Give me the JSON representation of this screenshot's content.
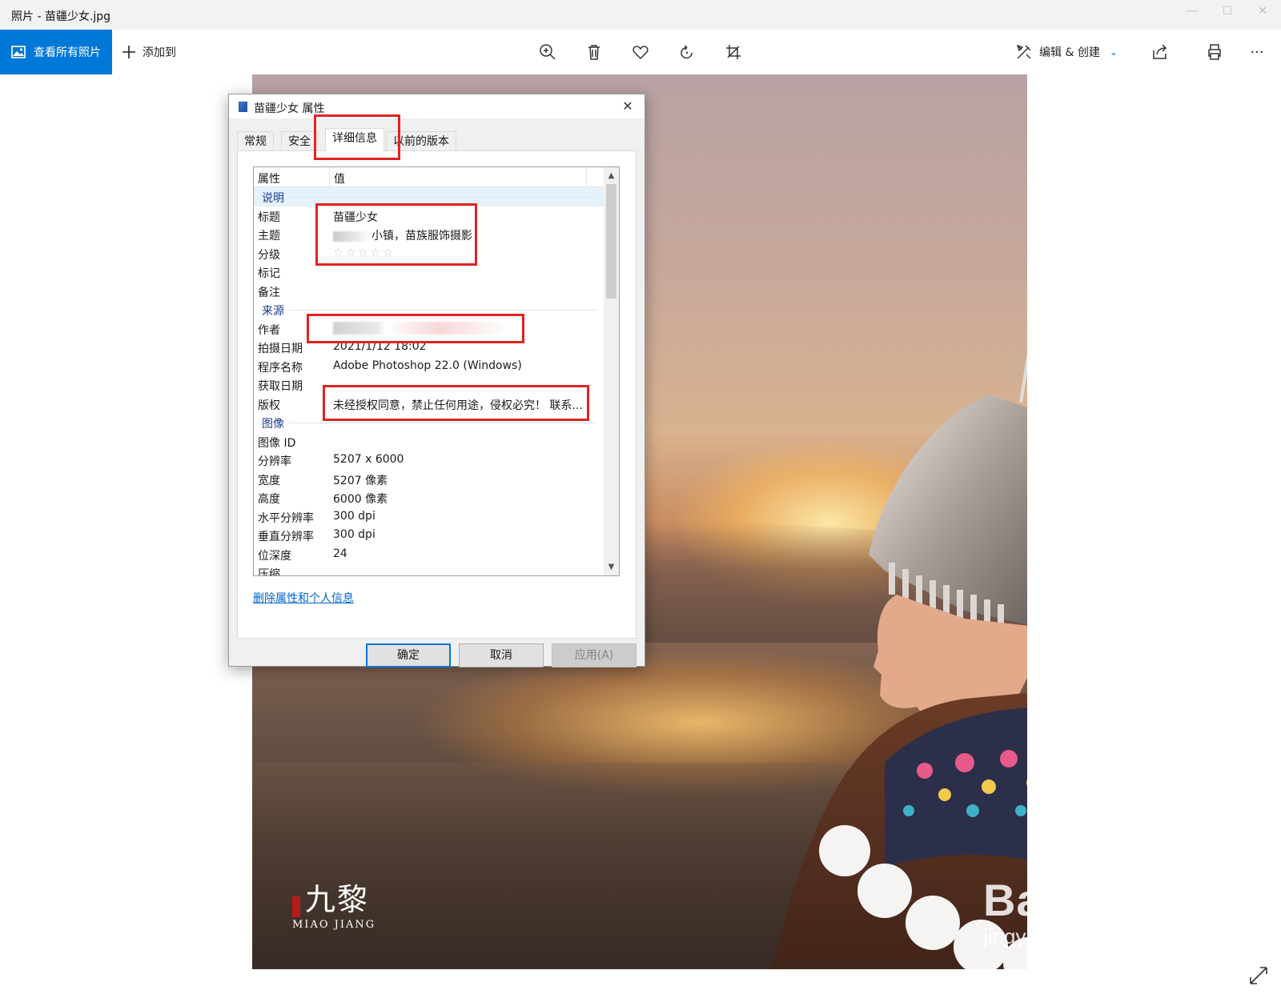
{
  "window": {
    "title": "照片 - 苗疆少女.jpg",
    "minimize": "—",
    "maximize": "☐",
    "close": "✕"
  },
  "toolbar": {
    "view_all_label": "查看所有照片",
    "add_to_label": "添加到",
    "edit_create_label": "编辑 & 创建",
    "edit_create_chevron": "⌄",
    "more_label": "···"
  },
  "dialog": {
    "title": "苗疆少女 属性",
    "close": "✕",
    "tabs": [
      "常规",
      "安全",
      "详细信息",
      "以前的版本"
    ],
    "active_tab": "详细信息",
    "columns": {
      "property": "属性",
      "value": "值"
    },
    "groups": {
      "description": "说明",
      "origin": "来源",
      "image": "图像"
    },
    "rows": {
      "title": {
        "k": "标题",
        "v": "苗疆少女"
      },
      "subject": {
        "k": "主题",
        "v": "小镇，苗族服饰摄影"
      },
      "rating": {
        "k": "分级",
        "v": "☆☆☆☆☆"
      },
      "tags": {
        "k": "标记",
        "v": ""
      },
      "comments": {
        "k": "备注",
        "v": ""
      },
      "authors": {
        "k": "作者",
        "v": ""
      },
      "date_taken": {
        "k": "拍摄日期",
        "v": "2021/1/12 18:02"
      },
      "program": {
        "k": "程序名称",
        "v": "Adobe Photoshop 22.0 (Windows)"
      },
      "date_acquired": {
        "k": "获取日期",
        "v": ""
      },
      "copyright": {
        "k": "版权",
        "v": "未经授权同意，禁止任何用途，侵权必究！ 联系..."
      },
      "image_id": {
        "k": "图像 ID",
        "v": ""
      },
      "dimensions": {
        "k": "分辨率",
        "v": "5207 x 6000"
      },
      "width": {
        "k": "宽度",
        "v": "5207 像素"
      },
      "height": {
        "k": "高度",
        "v": "6000 像素"
      },
      "h_res": {
        "k": "水平分辨率",
        "v": "300 dpi"
      },
      "v_res": {
        "k": "垂直分辨率",
        "v": "300 dpi"
      },
      "bit_depth": {
        "k": "位深度",
        "v": "24"
      },
      "compression": {
        "k": "压缩",
        "v": ""
      }
    },
    "remove_link": "删除属性和个人信息",
    "buttons": {
      "ok": "确定",
      "cancel": "取消",
      "apply": "应用(A)"
    }
  },
  "photo": {
    "watermark_big": "九黎",
    "watermark_small": "MIAO JIANG",
    "baidu_logo": "Bai都经验",
    "baidu_url": "jingyan.baidu.com"
  },
  "colors": {
    "accent": "#0078d7",
    "highlight": "#e02424",
    "group_text": "#1e3c8c",
    "link": "#0066cc"
  }
}
